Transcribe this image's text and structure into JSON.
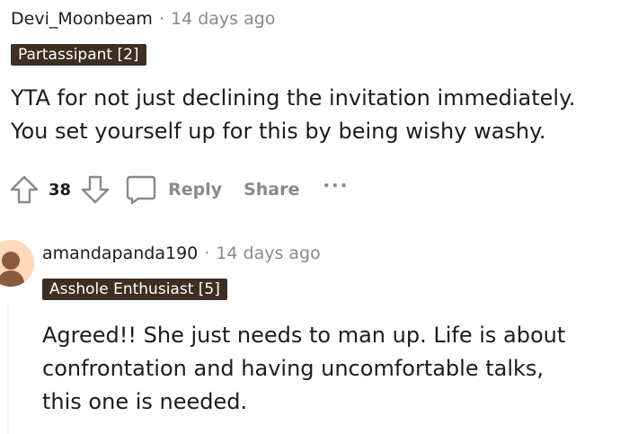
{
  "comments": [
    {
      "author": "Devi_Moonbeam",
      "separator": "·",
      "time": "14 days ago",
      "flair": "Partassipant [2]",
      "body": [
        "YTA for not just declining the invitation immediately.",
        "You set yourself up for this by being wishy washy."
      ],
      "score": "38",
      "reply_label": "Reply",
      "share_label": "Share",
      "more_label": "•••"
    },
    {
      "author": "amandapanda190",
      "separator": "·",
      "time": "14 days ago",
      "flair": "Asshole Enthusiast [5]",
      "body": [
        "Agreed!! She just needs to man up. Life is about",
        "confrontation and having uncomfortable talks,",
        "this one is needed."
      ]
    }
  ],
  "colors": {
    "flair_bg": "#3d2f22",
    "muted": "#878a8c",
    "avatar_bg": "#ffd9b8",
    "avatar_figure": "#8a5a3c"
  },
  "icons": [
    "upvote-icon",
    "downvote-icon",
    "comment-icon",
    "more-icon",
    "avatar-icon"
  ]
}
